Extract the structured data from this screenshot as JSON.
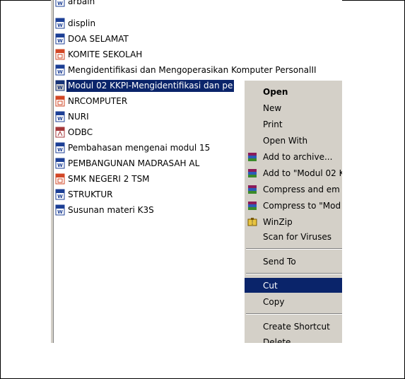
{
  "files": [
    {
      "name": "arbain",
      "type": "word"
    },
    {
      "name": "displin",
      "type": "word"
    },
    {
      "name": "DOA SELAMAT",
      "type": "word"
    },
    {
      "name": "KOMITE SEKOLAH",
      "type": "powerpoint"
    },
    {
      "name": "Mengidentifikasi dan Mengoperasikan Komputer PersonalII",
      "type": "word"
    },
    {
      "name": "Modul 02 KKPI-Mengidentifikasi dan pe",
      "type": "word",
      "selected": true
    },
    {
      "name": "NRCOMPUTER",
      "type": "powerpoint"
    },
    {
      "name": "NURI",
      "type": "word"
    },
    {
      "name": "ODBC",
      "type": "access"
    },
    {
      "name": "Pembahasan mengenai modul 15",
      "type": "word"
    },
    {
      "name": "PEMBANGUNAN MADRASAH AL",
      "type": "word"
    },
    {
      "name": "SMK NEGERI 2 TSM",
      "type": "powerpoint"
    },
    {
      "name": "STRUKTUR",
      "type": "word"
    },
    {
      "name": "Susunan materi K3S",
      "type": "word"
    }
  ],
  "context_menu": {
    "items": [
      {
        "label": "Open",
        "bold": true
      },
      {
        "label": "New"
      },
      {
        "label": "Print"
      },
      {
        "label": "Open With"
      },
      {
        "label": "Add to archive...",
        "icon": "winrar-icon"
      },
      {
        "label": "Add to \"Modul 02 K",
        "icon": "winrar-icon"
      },
      {
        "label": "Compress and em",
        "icon": "winrar-icon"
      },
      {
        "label": "Compress to \"Mod",
        "icon": "winrar-icon"
      },
      {
        "label": "WinZip",
        "icon": "winzip-icon"
      },
      {
        "label": "Scan for Viruses"
      },
      {
        "label": "Send To"
      },
      {
        "label": "Cut",
        "highlighted": true
      },
      {
        "label": "Copy"
      },
      {
        "label": "Create Shortcut"
      },
      {
        "label": "Delete"
      }
    ]
  },
  "colors": {
    "selection": "#0a246a",
    "menu_bg": "#d4d0c8",
    "word_icon": "#1c3f95",
    "powerpoint_icon": "#d24726",
    "access_icon": "#a4373a"
  }
}
